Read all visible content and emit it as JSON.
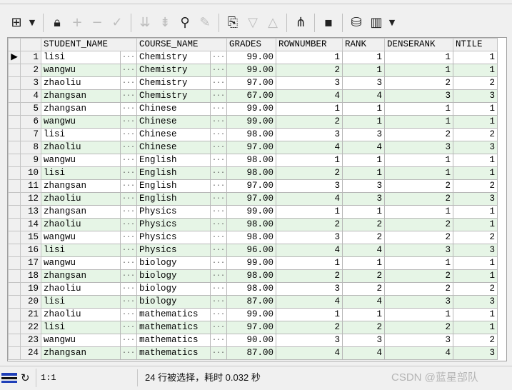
{
  "toolbar": {
    "icons": [
      "grid-icon",
      "dropdown-icon",
      "lock-icon",
      "plus-icon",
      "minus-icon",
      "check-icon",
      "filter-down-icon",
      "filter-clear-icon",
      "binoculars-icon",
      "eraser-icon",
      "export-icon",
      "arrow-down-icon",
      "arrow-up-icon",
      "query-plan-icon",
      "save-icon",
      "database-icon",
      "chart-icon",
      "dropdown-icon"
    ]
  },
  "grid": {
    "columns": [
      "STUDENT_NAME",
      "COURSE_NAME",
      "GRADES",
      "ROWNUMBER",
      "RANK",
      "DENSERANK",
      "NTILE"
    ],
    "rows": [
      {
        "n": "1",
        "student": "lisi",
        "course": "Chemistry",
        "grades": "99.00",
        "rownumber": "1",
        "rank": "1",
        "denserank": "1",
        "ntile": "1"
      },
      {
        "n": "2",
        "student": "wangwu",
        "course": "Chemistry",
        "grades": "99.00",
        "rownumber": "2",
        "rank": "1",
        "denserank": "1",
        "ntile": "1"
      },
      {
        "n": "3",
        "student": "zhaoliu",
        "course": "Chemistry",
        "grades": "97.00",
        "rownumber": "3",
        "rank": "3",
        "denserank": "2",
        "ntile": "2"
      },
      {
        "n": "4",
        "student": "zhangsan",
        "course": "Chemistry",
        "grades": "67.00",
        "rownumber": "4",
        "rank": "4",
        "denserank": "3",
        "ntile": "3"
      },
      {
        "n": "5",
        "student": "zhangsan",
        "course": "Chinese",
        "grades": "99.00",
        "rownumber": "1",
        "rank": "1",
        "denserank": "1",
        "ntile": "1"
      },
      {
        "n": "6",
        "student": "wangwu",
        "course": "Chinese",
        "grades": "99.00",
        "rownumber": "2",
        "rank": "1",
        "denserank": "1",
        "ntile": "1"
      },
      {
        "n": "7",
        "student": "lisi",
        "course": "Chinese",
        "grades": "98.00",
        "rownumber": "3",
        "rank": "3",
        "denserank": "2",
        "ntile": "2"
      },
      {
        "n": "8",
        "student": "zhaoliu",
        "course": "Chinese",
        "grades": "97.00",
        "rownumber": "4",
        "rank": "4",
        "denserank": "3",
        "ntile": "3"
      },
      {
        "n": "9",
        "student": "wangwu",
        "course": "English",
        "grades": "98.00",
        "rownumber": "1",
        "rank": "1",
        "denserank": "1",
        "ntile": "1"
      },
      {
        "n": "10",
        "student": "lisi",
        "course": "English",
        "grades": "98.00",
        "rownumber": "2",
        "rank": "1",
        "denserank": "1",
        "ntile": "1"
      },
      {
        "n": "11",
        "student": "zhangsan",
        "course": "English",
        "grades": "97.00",
        "rownumber": "3",
        "rank": "3",
        "denserank": "2",
        "ntile": "2"
      },
      {
        "n": "12",
        "student": "zhaoliu",
        "course": "English",
        "grades": "97.00",
        "rownumber": "4",
        "rank": "3",
        "denserank": "2",
        "ntile": "3"
      },
      {
        "n": "13",
        "student": "zhangsan",
        "course": "Physics",
        "grades": "99.00",
        "rownumber": "1",
        "rank": "1",
        "denserank": "1",
        "ntile": "1"
      },
      {
        "n": "14",
        "student": "zhaoliu",
        "course": "Physics",
        "grades": "98.00",
        "rownumber": "2",
        "rank": "2",
        "denserank": "2",
        "ntile": "1"
      },
      {
        "n": "15",
        "student": "wangwu",
        "course": "Physics",
        "grades": "98.00",
        "rownumber": "3",
        "rank": "2",
        "denserank": "2",
        "ntile": "2"
      },
      {
        "n": "16",
        "student": "lisi",
        "course": "Physics",
        "grades": "96.00",
        "rownumber": "4",
        "rank": "4",
        "denserank": "3",
        "ntile": "3"
      },
      {
        "n": "17",
        "student": "wangwu",
        "course": "biology",
        "grades": "99.00",
        "rownumber": "1",
        "rank": "1",
        "denserank": "1",
        "ntile": "1"
      },
      {
        "n": "18",
        "student": "zhangsan",
        "course": "biology",
        "grades": "98.00",
        "rownumber": "2",
        "rank": "2",
        "denserank": "2",
        "ntile": "1"
      },
      {
        "n": "19",
        "student": "zhaoliu",
        "course": "biology",
        "grades": "98.00",
        "rownumber": "3",
        "rank": "2",
        "denserank": "2",
        "ntile": "2"
      },
      {
        "n": "20",
        "student": "lisi",
        "course": "biology",
        "grades": "87.00",
        "rownumber": "4",
        "rank": "4",
        "denserank": "3",
        "ntile": "3"
      },
      {
        "n": "21",
        "student": "zhaoliu",
        "course": "mathematics",
        "grades": "99.00",
        "rownumber": "1",
        "rank": "1",
        "denserank": "1",
        "ntile": "1"
      },
      {
        "n": "22",
        "student": "lisi",
        "course": "mathematics",
        "grades": "97.00",
        "rownumber": "2",
        "rank": "2",
        "denserank": "2",
        "ntile": "1"
      },
      {
        "n": "23",
        "student": "wangwu",
        "course": "mathematics",
        "grades": "90.00",
        "rownumber": "3",
        "rank": "3",
        "denserank": "3",
        "ntile": "2"
      },
      {
        "n": "24",
        "student": "zhangsan",
        "course": "mathematics",
        "grades": "87.00",
        "rownumber": "4",
        "rank": "4",
        "denserank": "4",
        "ntile": "3"
      }
    ],
    "cell_button": "···",
    "current_row_marker": "▶"
  },
  "status": {
    "position": "1:1",
    "message": "24 行被选择，耗时 0.032 秒",
    "watermark": "CSDN @蓝星部队"
  },
  "colors": {
    "row_alt": "#e6f5e6",
    "row": "#ffffff",
    "header": "#f0f0f0"
  }
}
